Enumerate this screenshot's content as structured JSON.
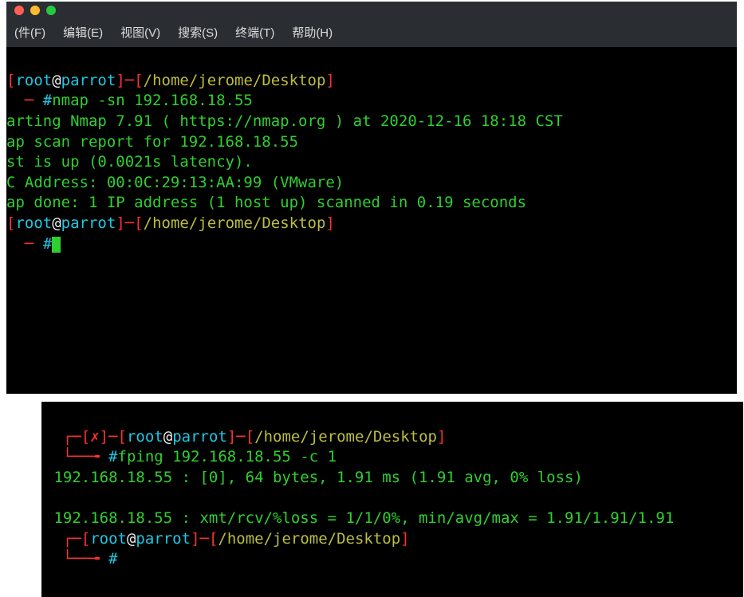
{
  "menubar": {
    "file": "(件(F)",
    "edit": "编辑(E)",
    "view": "视图(V)",
    "search": "搜索(S)",
    "terminal": "终端(T)",
    "help": "帮助(H)"
  },
  "term1": {
    "p1_br1": "[",
    "p1_user": "root",
    "p1_at": "@",
    "p1_host": "parrot",
    "p1_br2": "]─[",
    "p1_path": "/home/jerome/Desktop",
    "p1_br3": "]",
    "p1_arrow": "  ─ ",
    "p1_hash": "#",
    "cmd1": "nmap -sn 192.168.18.55",
    "out1": "arting Nmap 7.91 ( https://nmap.org ) at 2020-12-16 18:18 CST",
    "out2": "ap scan report for 192.168.18.55",
    "out3": "st is up (0.0021s latency).",
    "out4": "C Address: 00:0C:29:13:AA:99 (VMware)",
    "out5": "ap done: 1 IP address (1 host up) scanned in 0.19 seconds",
    "p2_br1": "[",
    "p2_user": "root",
    "p2_at": "@",
    "p2_host": "parrot",
    "p2_br2": "]─[",
    "p2_path": "/home/jerome/Desktop",
    "p2_br3": "]",
    "p2_arrow": "  ─ ",
    "p2_hash": "#"
  },
  "term2": {
    "p1_corner": "  ┌─[",
    "p1_x": "✗",
    "p1_mid": "]─[",
    "p1_user": "root",
    "p1_at": "@",
    "p1_host": "parrot",
    "p1_br2": "]─[",
    "p1_path": "/home/jerome/Desktop",
    "p1_br3": "]",
    "p1_elbow": "  └──╼ ",
    "p1_hash": "#",
    "cmd1": "fping 192.168.18.55 -c 1",
    "out1": " 192.168.18.55 : [0], 64 bytes, 1.91 ms (1.91 avg, 0% loss)",
    "blank": "",
    "out2": " 192.168.18.55 : xmt/rcv/%loss = 1/1/0%, min/avg/max = 1.91/1.91/1.91",
    "p2_corner": "  ┌─[",
    "p2_user": "root",
    "p2_at": "@",
    "p2_host": "parrot",
    "p2_br2": "]─[",
    "p2_path": "/home/jerome/Desktop",
    "p2_br3": "]",
    "p2_elbow": "  └──╼ ",
    "p2_hash": "#"
  }
}
